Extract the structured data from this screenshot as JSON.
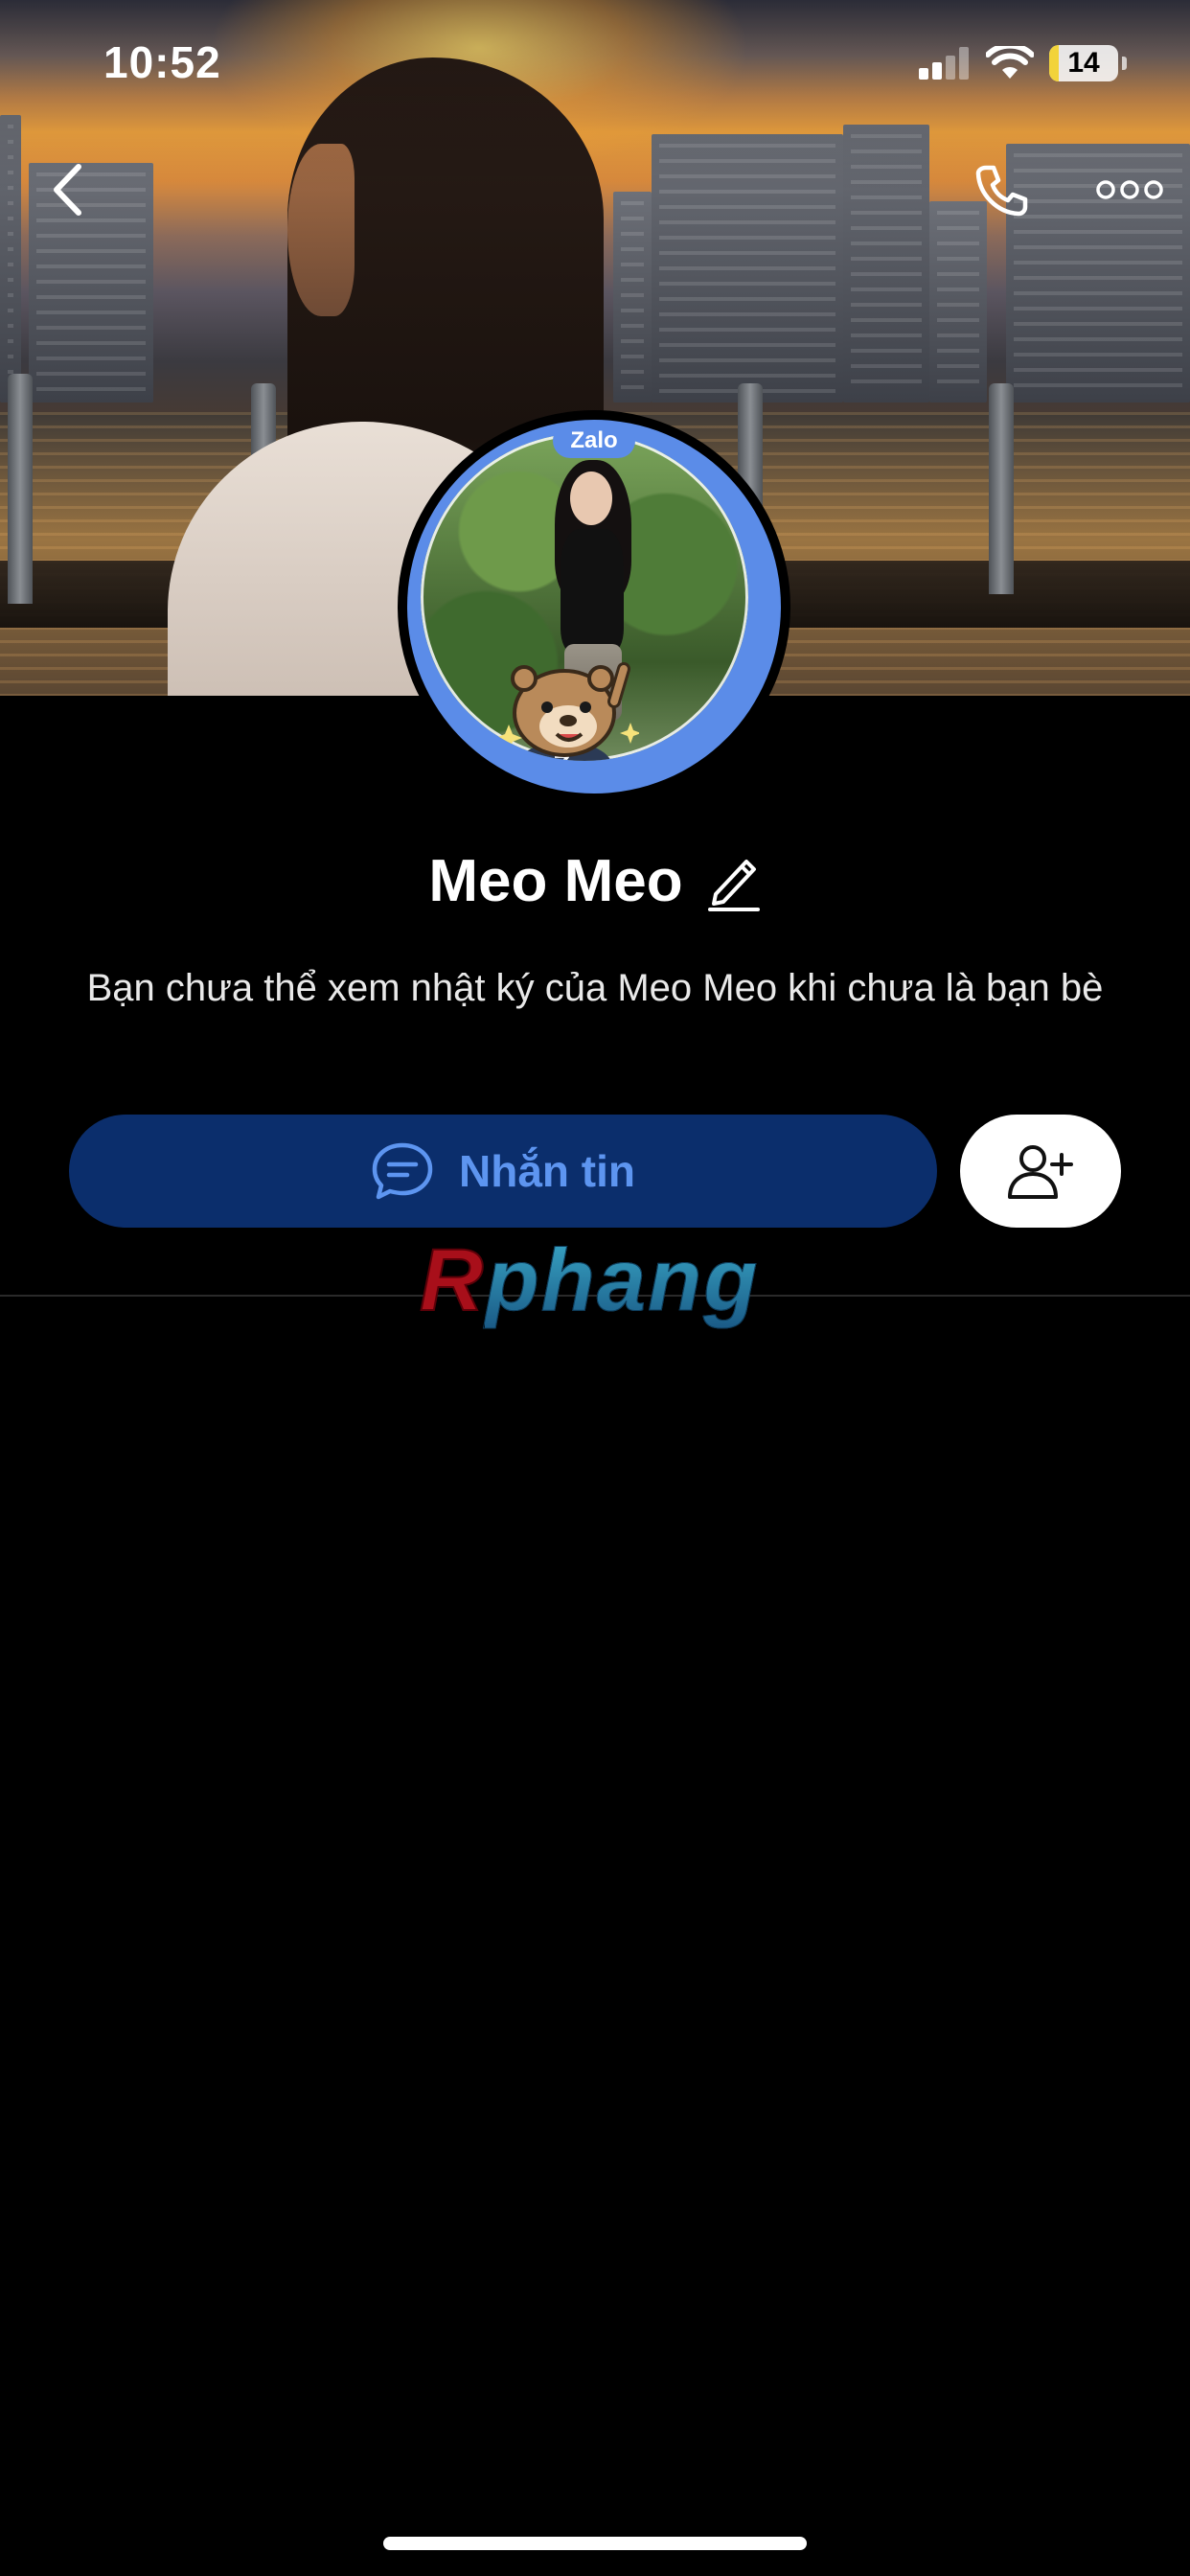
{
  "status_bar": {
    "time": "10:52",
    "battery_level": "14",
    "battery_fraction": 0.14,
    "signal_bars_active": 2,
    "signal_bars_total": 4
  },
  "nav": {
    "back_icon": "chevron-left-icon",
    "call_icon": "phone-icon",
    "more_icon": "more-dots-icon"
  },
  "avatar": {
    "badge_label": "Zalo",
    "ring_color": "#5b8ce8"
  },
  "profile": {
    "name": "Meo Meo",
    "edit_icon": "pencil-icon",
    "privacy_note": "Bạn chưa thể xem nhật ký của Meo Meo khi chưa là bạn bè"
  },
  "actions": {
    "message_label": "Nhắn tin",
    "message_icon": "chat-bubble-icon",
    "add_friend_icon": "add-friend-icon",
    "message_bg": "#0b2e6c",
    "message_fg": "#5d95f0"
  },
  "watermark": {
    "first_letter": "R",
    "rest": "phang"
  }
}
